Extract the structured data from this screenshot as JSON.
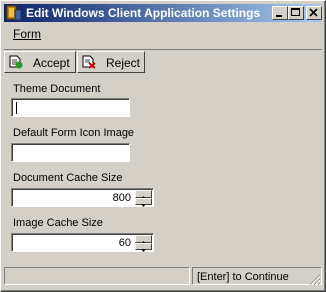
{
  "window": {
    "title": "Edit Windows Client Application Settings"
  },
  "menu": {
    "form_label": "Form"
  },
  "toolbar": {
    "accept_label": "Accept",
    "reject_label": "Reject"
  },
  "fields": {
    "theme_document": {
      "label": "Theme Document",
      "value": ""
    },
    "default_form_icon": {
      "label": "Default Form Icon Image",
      "value": ""
    },
    "document_cache_size": {
      "label": "Document Cache Size",
      "value": "800"
    },
    "image_cache_size": {
      "label": "Image Cache Size",
      "value": "60"
    }
  },
  "status": {
    "left_text": "",
    "right_text": "[Enter] to Continue"
  },
  "colors": {
    "title_start": "#0a246a",
    "title_end": "#a6caf0",
    "face": "#d4d0c8"
  }
}
